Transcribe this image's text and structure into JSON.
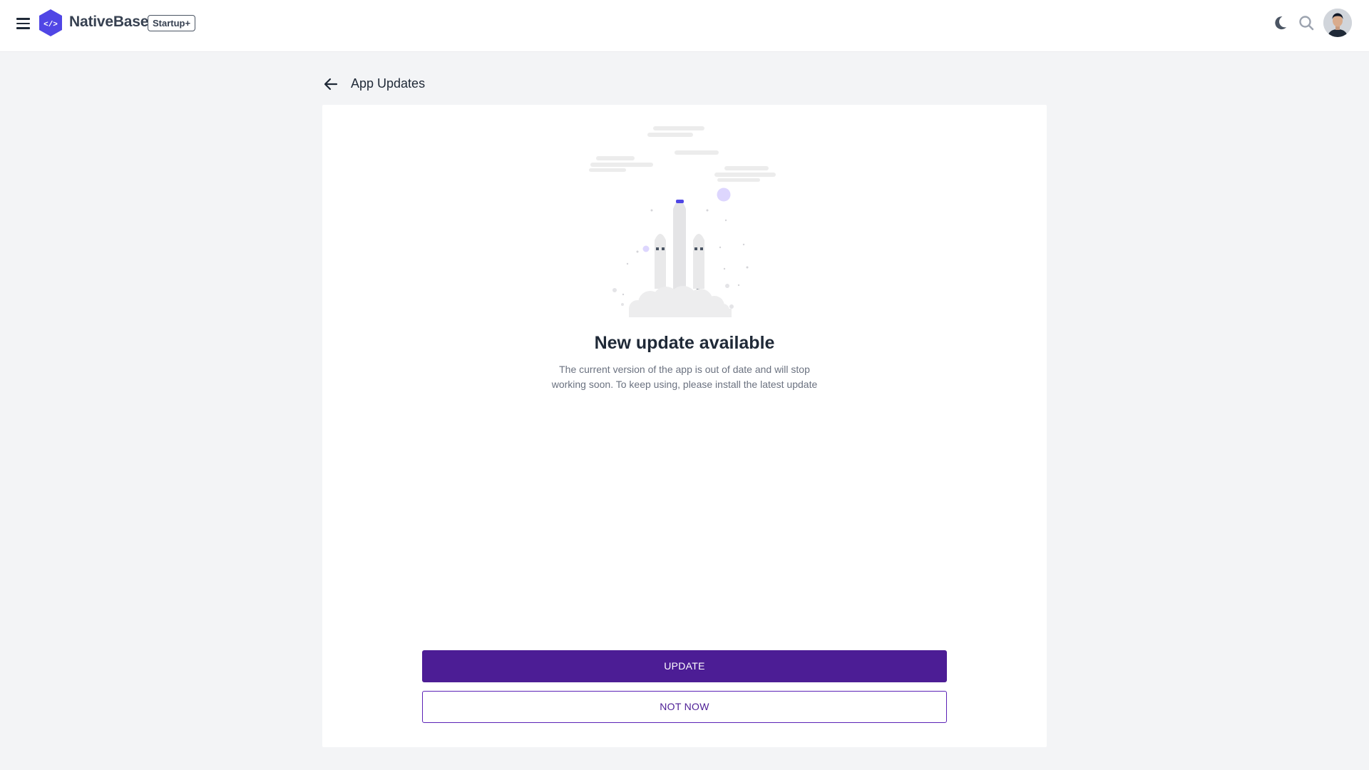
{
  "header": {
    "brand_name": "NativeBase",
    "plan_badge": "Startup+",
    "logo_glyph": "</>",
    "icons": [
      "menu-icon",
      "moon-icon",
      "search-icon",
      "avatar"
    ]
  },
  "page": {
    "title": "App Updates"
  },
  "update_prompt": {
    "headline": "New update available",
    "description": "The current version of the app is out of date and will stop working soon. To keep using, please install the latest update",
    "primary_label": "UPDATE",
    "secondary_label": "NOT NOW"
  },
  "colors": {
    "accent": "#4c1d95",
    "logo": "#5046e5",
    "background": "#f3f4f6"
  }
}
